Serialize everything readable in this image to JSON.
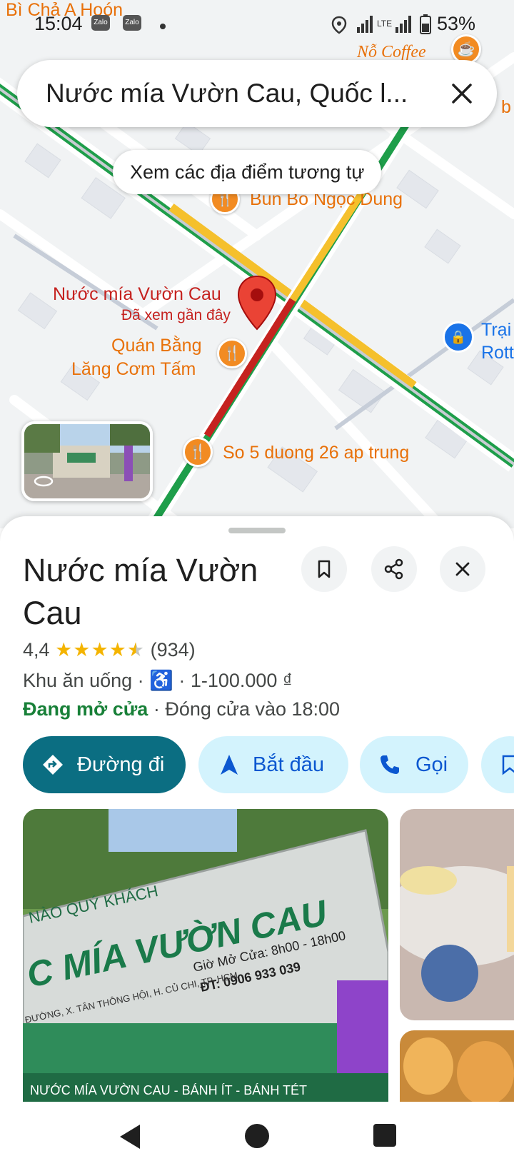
{
  "status_bar": {
    "time": "15:04",
    "apps": [
      "Zalo",
      "Zalo"
    ],
    "battery": "53%",
    "network": "LTE"
  },
  "search": {
    "query": "Nước mía Vườn Cau, Quốc l...",
    "close_icon": "close-icon"
  },
  "map": {
    "similar_chip": "Xem các địa điểm tương tự",
    "labels": {
      "top_left": "Bì Chả A Hoón",
      "coffee": "Nỗ Coffee",
      "bun_bo": "Bún Bò Ngọc Dung",
      "selected_name": "Nước mía Vườn Cau",
      "selected_sub": "Đã xem gần đây",
      "quan_line1": "Quán Bằng",
      "quan_line2": "Lăng Cơm Tấm",
      "so5": "So 5 duong 26 ap trung",
      "trai_line1": "Trại",
      "trai_line2": "Rott",
      "edge_b": "b"
    },
    "colors": {
      "road_green": "#1e9e4a",
      "road_yellow": "#f5c02c",
      "road_red": "#c5221f",
      "poi_orange": "#f28b22"
    }
  },
  "place": {
    "title": "Nước mía Vườn Cau",
    "rating": "4,4",
    "reviews": "(934)",
    "stars_value": 4.4,
    "category": "Khu ăn uống",
    "price": "1-100.000 ₫",
    "open_status": "Đang mở cửa",
    "close_time": "Đóng cửa vào 18:00",
    "separator": "·"
  },
  "header_buttons": [
    {
      "name": "save-button",
      "icon": "bookmark-icon"
    },
    {
      "name": "share-button",
      "icon": "share-icon"
    },
    {
      "name": "close-button",
      "icon": "close-icon"
    }
  ],
  "actions": {
    "directions": "Đường đi",
    "start": "Bắt đầu",
    "call": "Gọi"
  },
  "photo_sign": {
    "line_top": "NÀO QUÝ KHÁCH",
    "brand": "C MÍA VƯỜN CAU",
    "hours": "Giờ Mở Cửa: 8h00 - 18h00",
    "phone": "ĐT: 0906 933 039",
    "address": "ĐƯỜNG, X. TÂN THÔNG HỘI, H. CỦ CHI, TP. HCM",
    "banner": "NƯỚC MÍA VƯỜN CAU - BÁNH ÍT - BÁNH TÉT"
  },
  "navbar": {
    "back_icon": "back-triangle-icon",
    "home_icon": "home-circle-icon",
    "recents_icon": "recents-square-icon"
  }
}
